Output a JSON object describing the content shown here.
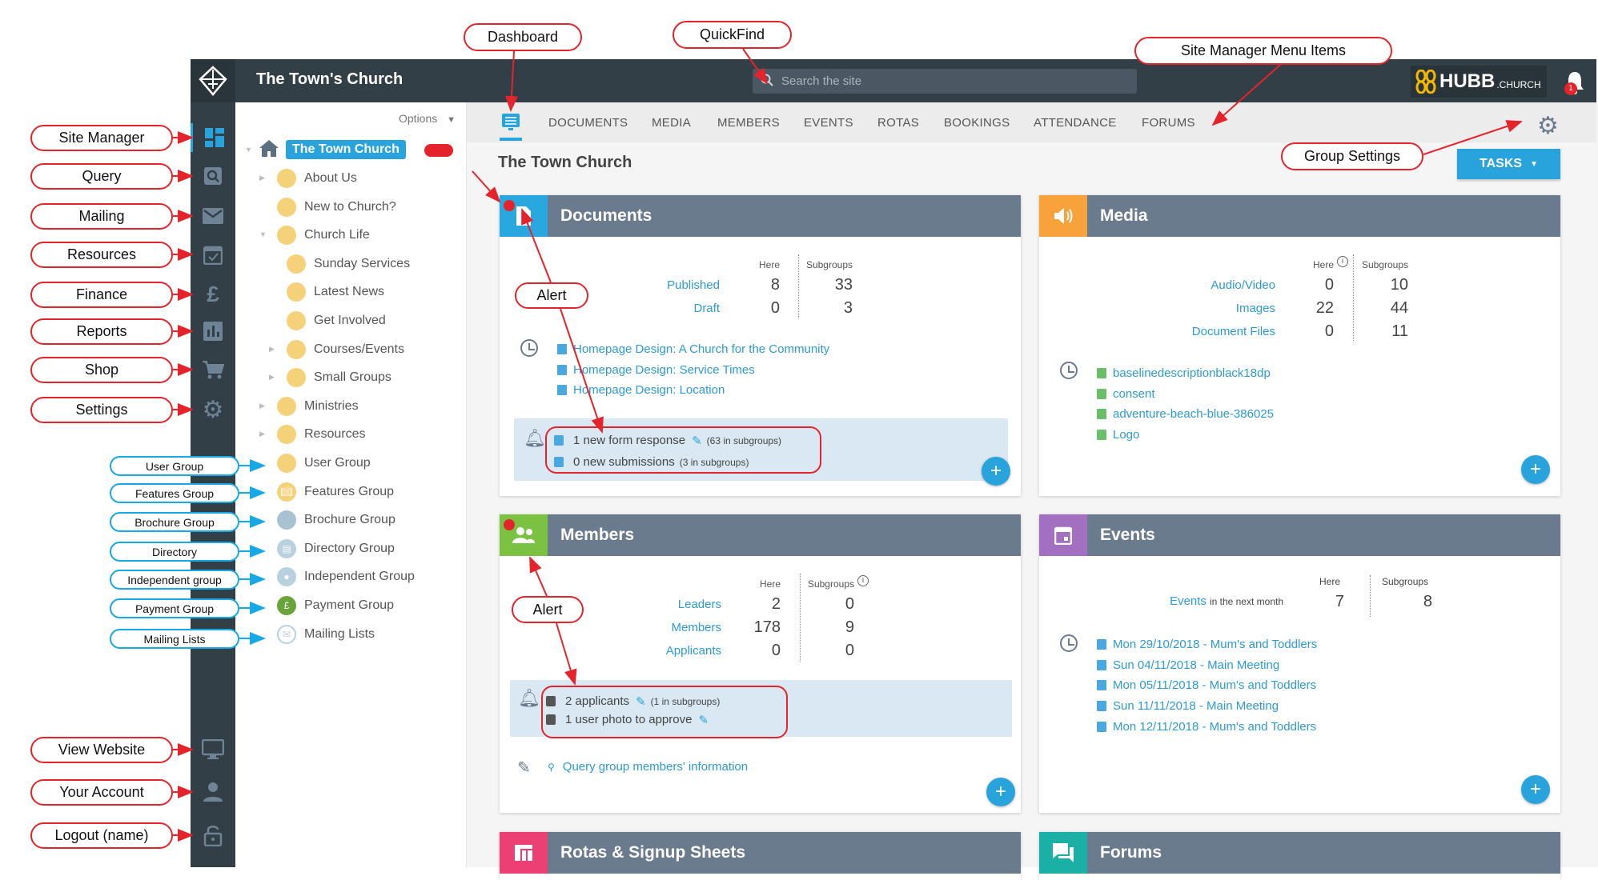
{
  "app": {
    "title": "The Town's Church",
    "search_placeholder": "Search the site",
    "brand": "HUBB",
    "brand_suffix": ".CHURCH",
    "notification_count": "1"
  },
  "rail": {
    "top": [
      {
        "icon": "dashboard-icon",
        "active": true
      },
      {
        "icon": "search-icon"
      },
      {
        "icon": "mail-icon"
      },
      {
        "icon": "calendar-check-icon"
      },
      {
        "icon": "pound-icon"
      },
      {
        "icon": "bar-chart-icon"
      },
      {
        "icon": "cart-icon"
      },
      {
        "icon": "gear-icon"
      }
    ],
    "bottom": [
      {
        "icon": "monitor-icon"
      },
      {
        "icon": "user-icon"
      },
      {
        "icon": "lock-icon"
      }
    ]
  },
  "tree": {
    "options_label": "Options",
    "root": "The Town Church",
    "items": [
      {
        "label": "About Us",
        "level": 1,
        "caret": "right",
        "icon": "yellow"
      },
      {
        "label": "New to Church?",
        "level": 1,
        "caret": "",
        "icon": "yellow"
      },
      {
        "label": "Church Life",
        "level": 1,
        "caret": "down",
        "icon": "yellow"
      },
      {
        "label": "Sunday Services",
        "level": 2,
        "caret": "",
        "icon": "yellow"
      },
      {
        "label": "Latest News",
        "level": 2,
        "caret": "",
        "icon": "yellow"
      },
      {
        "label": "Get Involved",
        "level": 2,
        "caret": "",
        "icon": "yellow"
      },
      {
        "label": "Courses/Events",
        "level": 2,
        "caret": "right",
        "icon": "yellow"
      },
      {
        "label": "Small Groups",
        "level": 2,
        "caret": "right",
        "icon": "yellow"
      },
      {
        "label": "Ministries",
        "level": 1,
        "caret": "right",
        "icon": "yellow"
      },
      {
        "label": "Resources",
        "level": 1,
        "caret": "right",
        "icon": "yellow"
      },
      {
        "label": "User Group",
        "level": 1,
        "caret": "",
        "icon": "yellow"
      },
      {
        "label": "Features Group",
        "level": 1,
        "caret": "",
        "icon": "features"
      },
      {
        "label": "Brochure Group",
        "level": 1,
        "caret": "",
        "icon": "brochure"
      },
      {
        "label": "Directory Group",
        "level": 1,
        "caret": "",
        "icon": "directory"
      },
      {
        "label": "Independent Group",
        "level": 1,
        "caret": "",
        "icon": "independent"
      },
      {
        "label": "Payment Group",
        "level": 1,
        "caret": "",
        "icon": "payment"
      },
      {
        "label": "Mailing Lists",
        "level": 1,
        "caret": "",
        "icon": "mailing"
      }
    ]
  },
  "nav": {
    "tabs": [
      "DOCUMENTS",
      "MEDIA",
      "MEMBERS",
      "EVENTS",
      "ROTAS",
      "BOOKINGS",
      "ATTENDANCE",
      "FORUMS"
    ]
  },
  "page": {
    "title": "The Town Church",
    "tasks_label": "TASKS"
  },
  "cards": {
    "documents": {
      "title": "Documents",
      "color": "#29a8e0",
      "here": "Here",
      "subgroups": "Subgroups",
      "rows": [
        {
          "label": "Published",
          "here": "8",
          "sub": "33"
        },
        {
          "label": "Draft",
          "here": "0",
          "sub": "3"
        }
      ],
      "recent": [
        "Homepage Design: A Church for the Community",
        "Homepage Design: Service Times",
        "Homepage Design: Location"
      ],
      "alerts": [
        {
          "text": "1 new form response",
          "note": "(63 in subgroups)",
          "edit": true
        },
        {
          "text": "0 new submissions",
          "note": "(3 in subgroups)",
          "edit": false
        }
      ]
    },
    "media": {
      "title": "Media",
      "color": "#f7a23b",
      "here": "Here",
      "subgroups": "Subgroups",
      "rows": [
        {
          "label": "Audio/Video",
          "here": "0",
          "sub": "10"
        },
        {
          "label": "Images",
          "here": "22",
          "sub": "44"
        },
        {
          "label": "Document Files",
          "here": "0",
          "sub": "11"
        }
      ],
      "recent": [
        "baselinedescriptionblack18dp",
        "consent",
        "adventure-beach-blue-386025",
        "Logo"
      ]
    },
    "members": {
      "title": "Members",
      "color": "#7cc242",
      "here": "Here",
      "subgroups": "Subgroups",
      "rows": [
        {
          "label": "Leaders",
          "here": "2",
          "sub": "0"
        },
        {
          "label": "Members",
          "here": "178",
          "sub": "9"
        },
        {
          "label": "Applicants",
          "here": "0",
          "sub": "0"
        }
      ],
      "alerts": [
        {
          "text": "2 applicants",
          "note": "(1 in subgroups)",
          "edit": true
        },
        {
          "text": "1 user photo to approve",
          "note": "",
          "edit": true
        }
      ],
      "query_link": "Query group members' information"
    },
    "events": {
      "title": "Events",
      "color": "#a36fc0",
      "here": "Here",
      "subgroups": "Subgroups",
      "row_label": "Events",
      "row_suffix": "in the next month",
      "row_here": "7",
      "row_sub": "8",
      "recent": [
        "Mon 29/10/2018 - Mum's and Toddlers",
        "Sun 04/11/2018 - Main Meeting",
        "Mon 05/11/2018 - Mum's and Toddlers",
        "Sun 11/11/2018 - Main Meeting",
        "Mon 12/11/2018 - Mum's and Toddlers"
      ]
    },
    "rotas": {
      "title": "Rotas & Signup Sheets",
      "color": "#ec3f74"
    },
    "forums": {
      "title": "Forums",
      "color": "#1bb0a6"
    }
  },
  "annotations": {
    "site_manager": "Site Manager",
    "query": "Query",
    "mailing": "Mailing",
    "resources": "Resources",
    "finance": "Finance",
    "reports": "Reports",
    "shop": "Shop",
    "settings": "Settings",
    "view_website": "View Website",
    "your_account": "Your Account",
    "logout": "Logout (name)",
    "dashboard": "Dashboard",
    "quickfind": "QuickFind",
    "menu_items": "Site Manager Menu Items",
    "group_settings": "Group Settings",
    "alert": "Alert",
    "user_group": "User Group",
    "features_group": "Features Group",
    "brochure_group": "Brochure Group",
    "directory": "Directory",
    "independent_group": "Independent group",
    "payment_group": "Payment Group",
    "mailing_lists": "Mailing Lists"
  },
  "colors": {
    "accent": "#29a3dc",
    "topbar": "#333f47",
    "card_header": "#6b7b8e",
    "annotation_red": "#e4232b",
    "annotation_blue": "#17a9e6"
  }
}
